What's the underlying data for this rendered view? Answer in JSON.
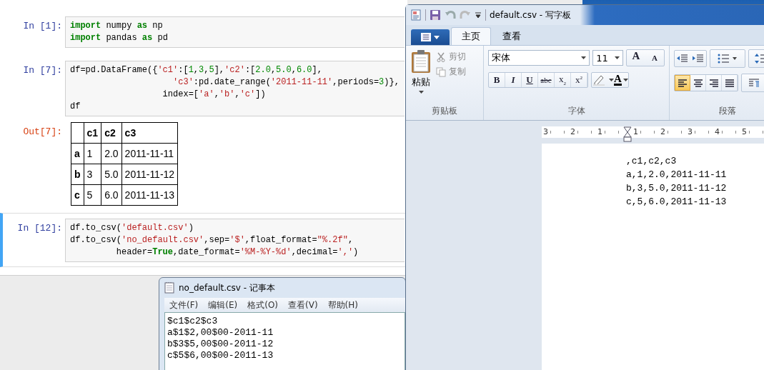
{
  "notebook": {
    "cells": [
      {
        "prompt": "In [1]:",
        "selected": false,
        "lines": [
          [
            {
              "text": "import",
              "kind": "keyword"
            },
            {
              "text": " numpy ",
              "kind": "plain"
            },
            {
              "text": "as",
              "kind": "keyword"
            },
            {
              "text": " np",
              "kind": "plain"
            }
          ],
          [
            {
              "text": "import",
              "kind": "keyword"
            },
            {
              "text": " pandas ",
              "kind": "plain"
            },
            {
              "text": "as",
              "kind": "keyword"
            },
            {
              "text": " pd",
              "kind": "plain"
            }
          ]
        ]
      },
      {
        "prompt": "In [7]:",
        "selected": false,
        "lines": [
          [
            {
              "text": "df=pd.DataFrame({",
              "kind": "plain"
            },
            {
              "text": "'c1'",
              "kind": "string"
            },
            {
              "text": ":[",
              "kind": "plain"
            },
            {
              "text": "1",
              "kind": "number"
            },
            {
              "text": ",",
              "kind": "plain"
            },
            {
              "text": "3",
              "kind": "number"
            },
            {
              "text": ",",
              "kind": "plain"
            },
            {
              "text": "5",
              "kind": "number"
            },
            {
              "text": "],",
              "kind": "plain"
            },
            {
              "text": "'c2'",
              "kind": "string"
            },
            {
              "text": ":[",
              "kind": "plain"
            },
            {
              "text": "2.0",
              "kind": "number"
            },
            {
              "text": ",",
              "kind": "plain"
            },
            {
              "text": "5.0",
              "kind": "number"
            },
            {
              "text": ",",
              "kind": "plain"
            },
            {
              "text": "6.0",
              "kind": "number"
            },
            {
              "text": "],",
              "kind": "plain"
            }
          ],
          [
            {
              "text": "                    'c3'",
              "kind": "string"
            },
            {
              "text": ":pd.date_range(",
              "kind": "plain"
            },
            {
              "text": "'2011-11-11'",
              "kind": "string"
            },
            {
              "text": ",periods=",
              "kind": "plain"
            },
            {
              "text": "3",
              "kind": "number"
            },
            {
              "text": ")},",
              "kind": "plain"
            }
          ],
          [
            {
              "text": "                  index=[",
              "kind": "plain"
            },
            {
              "text": "'a'",
              "kind": "string"
            },
            {
              "text": ",",
              "kind": "plain"
            },
            {
              "text": "'b'",
              "kind": "string"
            },
            {
              "text": ",",
              "kind": "plain"
            },
            {
              "text": "'c'",
              "kind": "string"
            },
            {
              "text": "])",
              "kind": "plain"
            }
          ],
          [
            {
              "text": "df",
              "kind": "plain"
            }
          ]
        ],
        "output": {
          "prompt": "Out[7]:",
          "columns": [
            "c1",
            "c2",
            "c3"
          ],
          "rows": [
            {
              "index": "a",
              "cells": [
                "1",
                "2.0",
                "2011-11-11"
              ]
            },
            {
              "index": "b",
              "cells": [
                "3",
                "5.0",
                "2011-11-12"
              ]
            },
            {
              "index": "c",
              "cells": [
                "5",
                "6.0",
                "2011-11-13"
              ]
            }
          ]
        }
      },
      {
        "prompt": "In [12]:",
        "selected": true,
        "lines": [
          [
            {
              "text": "df.to_csv(",
              "kind": "plain"
            },
            {
              "text": "'default.csv'",
              "kind": "string"
            },
            {
              "text": ")",
              "kind": "plain"
            }
          ],
          [
            {
              "text": "df.to_csv(",
              "kind": "plain"
            },
            {
              "text": "'no_default.csv'",
              "kind": "string"
            },
            {
              "text": ",sep=",
              "kind": "plain"
            },
            {
              "text": "'$'",
              "kind": "string"
            },
            {
              "text": ",float_format=",
              "kind": "plain"
            },
            {
              "text": "\"%.2f\"",
              "kind": "string"
            },
            {
              "text": ",",
              "kind": "plain"
            }
          ],
          [
            {
              "text": "         header=",
              "kind": "plain"
            },
            {
              "text": "True",
              "kind": "keyword"
            },
            {
              "text": ",date_format=",
              "kind": "plain"
            },
            {
              "text": "'%M-%Y-%d'",
              "kind": "string"
            },
            {
              "text": ",decimal=",
              "kind": "plain"
            },
            {
              "text": "','",
              "kind": "string"
            },
            {
              "text": ")",
              "kind": "plain"
            }
          ]
        ]
      }
    ]
  },
  "wordpad": {
    "title": "default.csv - 写字板",
    "tabs": [
      {
        "label": "主页",
        "selected": true
      },
      {
        "label": "查看",
        "selected": false
      }
    ],
    "clipboard": {
      "paste": "粘贴",
      "cut": {
        "label": "剪切",
        "disabled": true
      },
      "copy": {
        "label": "复制",
        "disabled": true
      },
      "label": "剪贴板"
    },
    "font": {
      "name": "宋体",
      "size": "11",
      "grow": "A",
      "shrink": "A",
      "format_buttons": [
        "B",
        "I",
        "U",
        "abc",
        "x$_{2}$",
        "x$^{2}$"
      ],
      "color_button": "A",
      "label": "字体"
    },
    "paragraph": {
      "align_buttons": [
        {
          "kind": "left",
          "selected": true
        },
        {
          "kind": "center",
          "selected": false
        },
        {
          "kind": "right",
          "selected": false
        },
        {
          "kind": "justify",
          "selected": false
        }
      ],
      "label": "段落"
    },
    "ruler": [
      "3",
      "2",
      "1",
      "1",
      "2",
      "3",
      "4",
      "5"
    ],
    "document_lines": [
      ",c1,c2,c3",
      "a,1,2.0,2011-11-11",
      "b,3,5.0,2011-11-12",
      "c,5,6.0,2011-11-13"
    ]
  },
  "notepad": {
    "title": "no_default.csv - 记事本",
    "menu": [
      "文件(F)",
      "编辑(E)",
      "格式(O)",
      "查看(V)",
      "帮助(H)"
    ],
    "lines": [
      "$c1$c2$c3",
      "a$1$2,00$00-2011-11",
      "b$3$5,00$00-2011-12",
      "c$5$6,00$00-2011-13"
    ]
  }
}
